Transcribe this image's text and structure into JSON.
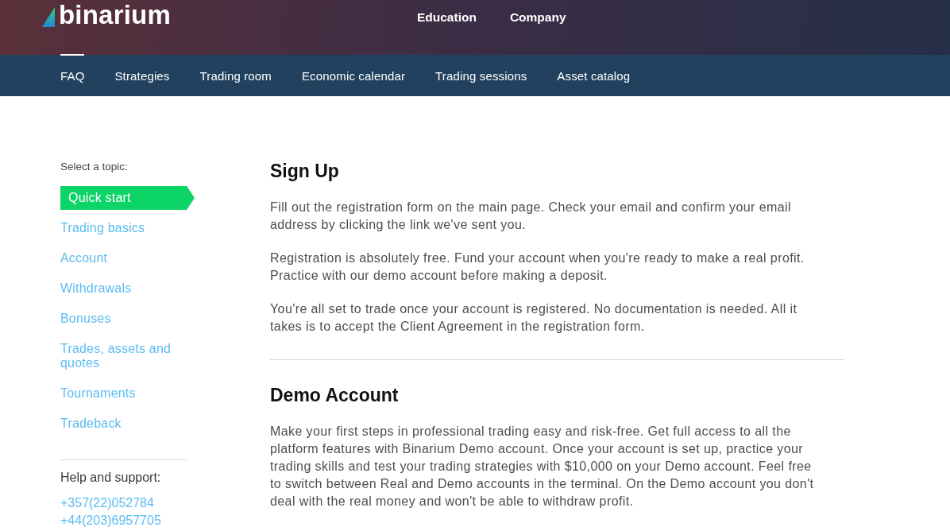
{
  "header": {
    "logo": "binarium",
    "nav": [
      {
        "label": "Education"
      },
      {
        "label": "Company"
      }
    ]
  },
  "subnav": [
    {
      "label": "FAQ",
      "selected": true
    },
    {
      "label": "Strategies",
      "selected": false
    },
    {
      "label": "Trading room",
      "selected": false
    },
    {
      "label": "Economic calendar",
      "selected": false
    },
    {
      "label": "Trading sessions",
      "selected": false
    },
    {
      "label": "Asset catalog",
      "selected": false
    }
  ],
  "sidebar": {
    "heading": "Select a topic:",
    "topics": [
      {
        "label": "Quick start",
        "selected": true
      },
      {
        "label": "Trading basics",
        "selected": false
      },
      {
        "label": "Account",
        "selected": false
      },
      {
        "label": "Withdrawals",
        "selected": false
      },
      {
        "label": "Bonuses",
        "selected": false
      },
      {
        "label": "Trades, assets and quotes",
        "selected": false
      },
      {
        "label": "Tournaments",
        "selected": false
      },
      {
        "label": "Tradeback",
        "selected": false
      }
    ],
    "support": {
      "heading": "Help and support:",
      "phones": [
        "+357(22)052784",
        "+44(203)6957705"
      ]
    }
  },
  "sections": [
    {
      "title": "Sign Up",
      "paragraphs": [
        "Fill out the registration form on the main page. Check your email and confirm your email address by clicking the link we've sent you.",
        "Registration is absolutely free. Fund your account when you're ready to make a real profit. Practice with our demo account before making a deposit.",
        "You're all set to trade once your account is registered. No documentation is needed. All it takes is to accept the Client Agreement in the registration form."
      ]
    },
    {
      "title": "Demo Account",
      "paragraphs": [
        "Make your first steps in professional trading easy and risk-free. Get full access to all the platform features with Binarium Demo account. Once your account is set up, practice your trading skills and test your trading strategies with $10,000 on your Demo account. Feel free to switch between Real and Demo accounts in the terminal. On the Demo account you don't deal with the real money and won't be able to withdraw profit."
      ]
    }
  ]
}
